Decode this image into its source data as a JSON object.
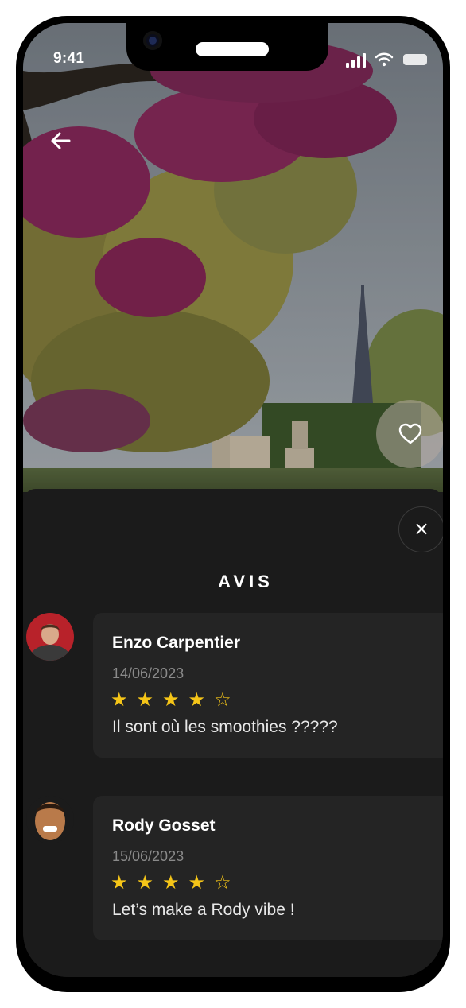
{
  "status_bar": {
    "time": "9:41"
  },
  "header": {
    "back_icon": "arrow-left-icon",
    "favorite_icon": "heart-outline-icon"
  },
  "sheet": {
    "close_icon": "close-icon",
    "close_glyph": "×",
    "title": "AVIS"
  },
  "reviews": [
    {
      "name": "Enzo Carpentier",
      "date": "14/06/2023",
      "rating": 4,
      "max_rating": 5,
      "text": "Il sont où les smoothies ?????"
    },
    {
      "name": "Rody Gosset",
      "date": "15/06/2023",
      "rating": 4,
      "max_rating": 5,
      "text": "Let’s make a Rody vibe !"
    }
  ],
  "colors": {
    "background": "#1b1b1b",
    "card": "#242424",
    "star": "#f5c518",
    "text": "#ffffff",
    "muted": "#8a8a8a"
  }
}
